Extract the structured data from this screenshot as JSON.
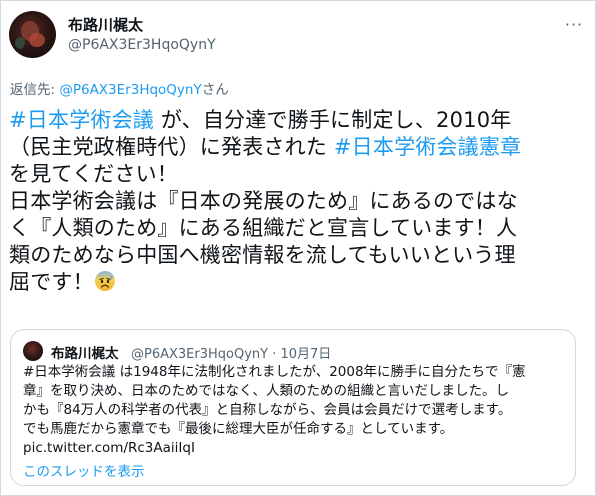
{
  "author": {
    "display_name": "布路川梶太",
    "handle": "@P6AX3Er3HqoQynY"
  },
  "more_glyph": "···",
  "reply": {
    "prefix": "返信先: ",
    "mention": "@P6AX3Er3HqoQynY",
    "suffix": "さん"
  },
  "tweet": {
    "line1_hashtag": "#日本学術会議",
    "line1_text": " が、自分達で勝手に制定し、2010年",
    "line2_text": "（民主党政権時代）に発表された ",
    "line2_hashtag": "#日本学術会議憲章",
    "line3_text": "を見てください！",
    "line4_text": "日本学術会議は『日本の発展のため』にあるのではな",
    "line5_text": "く『人類のため』にある組織だと宣言しています！人",
    "line6_text": "類のためなら中国へ機密情報を流してもいいという理",
    "line7_text": "屈です！",
    "emoji": "anxious-face-with-sweat"
  },
  "quote": {
    "display_name": "布路川梶太",
    "meta": "@P6AX3Er3HqoQynY · 10月7日",
    "lines": [
      "#日本学術会議 は1948年に法制化されましたが、2008年に勝手に自分たちで『憲",
      "章』を取り決め、日本のためではなく、人類のための組織と言いだしました。し",
      "かも『84万人の科学者の代表』と自称しながら、会員は会員だけで選考します。",
      "でも馬鹿だから憲章でも『最後に総理大臣が任命する』としています。"
    ],
    "link": "pic.twitter.com/Rc3AaiiIqI",
    "show_thread": "このスレッドを表示"
  },
  "colors": {
    "link": "#1d9bf0",
    "secondary": "#536471",
    "text": "#0f1419",
    "border": "#cfd9de"
  }
}
